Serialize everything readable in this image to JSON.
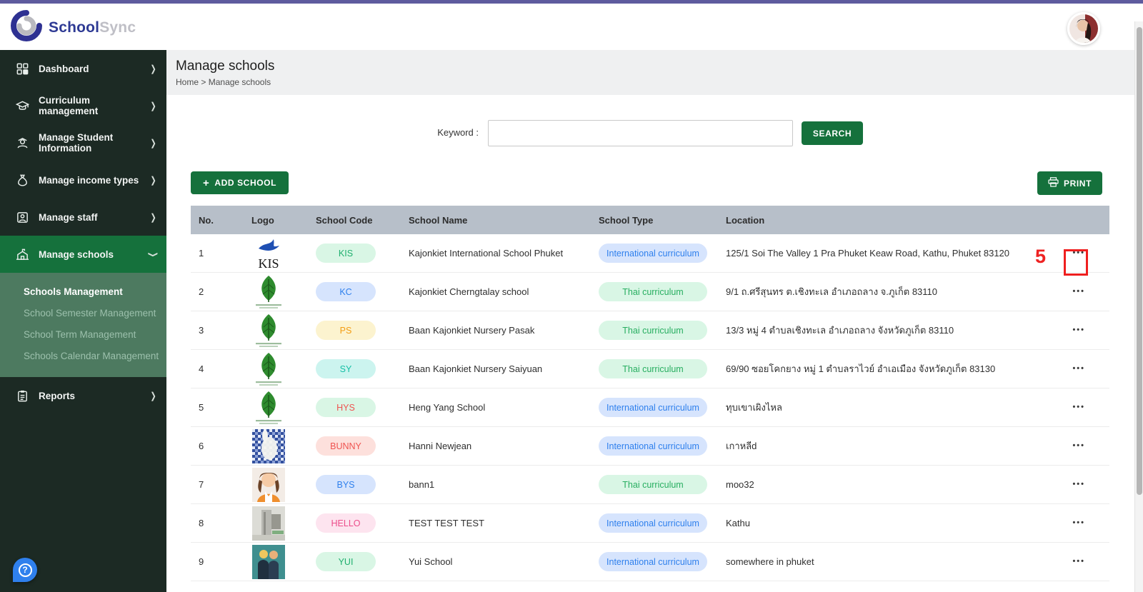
{
  "brand": {
    "name_primary": "School",
    "name_secondary": "Sync"
  },
  "page": {
    "title": "Manage schools",
    "breadcrumb": {
      "home": "Home",
      "separator": ">",
      "current": "Manage schools"
    }
  },
  "sidebar": {
    "items": [
      {
        "label": "Dashboard",
        "icon": "grid-icon"
      },
      {
        "label": "Curriculum management",
        "icon": "graduation-cap-icon"
      },
      {
        "label": "Manage Student Information",
        "icon": "student-icon"
      },
      {
        "label": "Manage income types",
        "icon": "money-bag-icon"
      },
      {
        "label": "Manage staff",
        "icon": "staff-icon"
      },
      {
        "label": "Manage schools",
        "icon": "school-icon",
        "active": true
      },
      {
        "label": "Reports",
        "icon": "report-icon"
      }
    ],
    "submenu": {
      "items": [
        {
          "label": "Schools Management",
          "active": true
        },
        {
          "label": "School Semester Management"
        },
        {
          "label": "School Term Management"
        },
        {
          "label": "Schools Calendar Management"
        }
      ]
    }
  },
  "search": {
    "label": "Keyword :",
    "value": "",
    "button_label": "SEARCH"
  },
  "toolbar": {
    "add_plus": "+",
    "add_label": "ADD SCHOOL",
    "print_label": "PRINT"
  },
  "annotation": {
    "mark": "5"
  },
  "table": {
    "headers": [
      "No.",
      "Logo",
      "School Code",
      "School Name",
      "School Type",
      "Location"
    ],
    "action_glyph": "•••",
    "rows": [
      {
        "no": "1",
        "logo": "kis",
        "code": "KIS",
        "code_style": "green",
        "name": "Kajonkiet International School Phuket",
        "type": "International curriculum",
        "type_style": "international",
        "location": "125/1 Soi The Valley 1 Pra Phuket Keaw Road, Kathu, Phuket 83120"
      },
      {
        "no": "2",
        "logo": "leaf",
        "code": "KC",
        "code_style": "blue",
        "name": "Kajonkiet Cherngtalay school",
        "type": "Thai curriculum",
        "type_style": "thai",
        "location": "9/1 ถ.ศรีสุนทร ต.เชิงทะเล อำเภอถลาง จ.ภูเก็ต 83110"
      },
      {
        "no": "3",
        "logo": "leaf",
        "code": "PS",
        "code_style": "yellow",
        "name": "Baan Kajonkiet Nursery Pasak",
        "type": "Thai curriculum",
        "type_style": "thai",
        "location": "13/3 หมู่ 4 ตำบลเชิงทะเล อำเภอถลาง จังหวัดภูเก็ต 83110"
      },
      {
        "no": "4",
        "logo": "leaf",
        "code": "SY",
        "code_style": "teal",
        "name": "Baan Kajonkiet Nursery Saiyuan",
        "type": "Thai curriculum",
        "type_style": "thai",
        "location": "69/90 ซอยโคกยาง หมู่ 1 ตำบลราไวย์ อำเอเมือง จังหวัดภูเก็ต 83130"
      },
      {
        "no": "5",
        "logo": "leaf",
        "code": "HYS",
        "code_style": "green-red",
        "name": "Heng Yang School",
        "type": "International curriculum",
        "type_style": "international",
        "location": "ทุบเขาเผิงไหล"
      },
      {
        "no": "6",
        "logo": "bunny",
        "code": "BUNNY",
        "code_style": "red",
        "name": "Hanni Newjean",
        "type": "International curriculum",
        "type_style": "international",
        "location": "เกาหลีd"
      },
      {
        "no": "7",
        "logo": "woman",
        "code": "BYS",
        "code_style": "blue",
        "name": "bann1",
        "type": "Thai curriculum",
        "type_style": "thai",
        "location": "moo32"
      },
      {
        "no": "8",
        "logo": "building",
        "code": "HELLO",
        "code_style": "pink",
        "name": "TEST TEST TEST",
        "type": "International curriculum",
        "type_style": "international",
        "location": "Kathu"
      },
      {
        "no": "9",
        "logo": "men",
        "code": "YUI",
        "code_style": "green",
        "name": "Yui School",
        "type": "International curriculum",
        "type_style": "international",
        "location": "somewhere in phuket"
      }
    ]
  },
  "colors": {
    "topbar": "#5e5b9e",
    "brand_primary": "#2e3a94",
    "brand_secondary": "#bfbfc6",
    "sidebar_bg": "#1c2a24",
    "active_green": "#15713c",
    "submenu_bg": "#4d7a60",
    "band_bg": "#eff0f1",
    "table_header_bg": "#b7bfc9",
    "annotation_red": "#ee2222",
    "badges": {
      "green": {
        "bg": "#d9f6e5",
        "fg": "#1faf6e"
      },
      "blue": {
        "bg": "#d6e4fd",
        "fg": "#2f80ed"
      },
      "yellow": {
        "bg": "#fcf3cf",
        "fg": "#f39c12"
      },
      "teal": {
        "bg": "#ccf4ef",
        "fg": "#16bfa6"
      },
      "green-red": {
        "bg": "#d9f6e5",
        "fg": "#ef5350"
      },
      "red": {
        "bg": "#fde0dc",
        "fg": "#ef5350"
      },
      "pink": {
        "bg": "#fde4ef",
        "fg": "#ec4d8b"
      }
    },
    "types": {
      "international": {
        "bg": "#d6e4fd",
        "fg": "#2f80ed"
      },
      "thai": {
        "bg": "#d9f6e5",
        "fg": "#27ae60"
      }
    }
  }
}
